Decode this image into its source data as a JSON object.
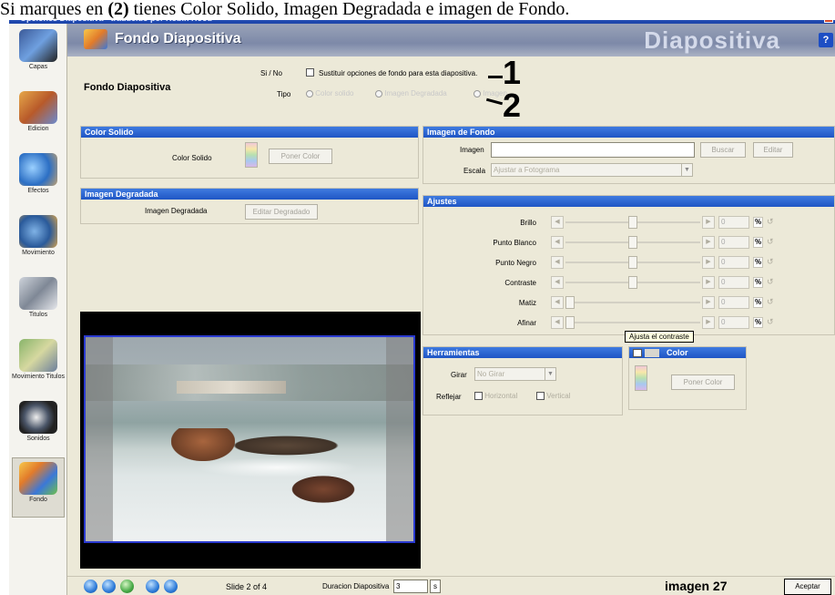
{
  "caption": "Si marques en (2) tienes Color Solido, Imagen Degradada e imagen de Fondo.",
  "caption_bold": "(2)",
  "window_title": "Opciones Diapositiva - traducido por Robin Hood",
  "sidebar": {
    "items": [
      {
        "label": "Capas",
        "icon": "layers-icon"
      },
      {
        "label": "Edicion",
        "icon": "edit-icon"
      },
      {
        "label": "Efectos",
        "icon": "effects-icon"
      },
      {
        "label": "Movimiento",
        "icon": "motion-icon"
      },
      {
        "label": "Titulos",
        "icon": "titles-icon"
      },
      {
        "label": "Movimiento Titulos",
        "icon": "title-motion-icon"
      },
      {
        "label": "Sonidos",
        "icon": "sounds-icon"
      },
      {
        "label": "Fondo",
        "icon": "background-icon"
      }
    ]
  },
  "header": {
    "title": "Fondo Diapositiva",
    "big_title": "Diapositiva",
    "help": "?"
  },
  "top": {
    "section_label": "Fondo Diapositiva",
    "sino_label": "Si / No",
    "sino_text": "Sustituir opciones de fondo para esta diapositiva.",
    "tipo_label": "Tipo",
    "tipo_options": [
      "Color solido",
      "Imagen Degradada",
      "Imagen"
    ],
    "annotation_1": "1",
    "annotation_2": "2"
  },
  "color_solido": {
    "header": "Color Solido",
    "label": "Color Solido",
    "button": "Poner Color"
  },
  "imagen_degradada": {
    "header": "Imagen Degradada",
    "label": "Imagen Degradada",
    "button": "Editar Degradado"
  },
  "imagen_fondo": {
    "header": "Imagen de Fondo",
    "imagen_label": "Imagen",
    "imagen_value": "",
    "buscar": "Buscar",
    "editar": "Editar",
    "escala_label": "Escala",
    "escala_value": "Ajustar a Fotograma"
  },
  "ajustes": {
    "header": "Ajustes",
    "rows": [
      {
        "label": "Brillo",
        "value": "0",
        "pct": "%",
        "pos": 0.5
      },
      {
        "label": "Punto Blanco",
        "value": "0",
        "pct": "%",
        "pos": 0.5
      },
      {
        "label": "Punto Negro",
        "value": "0",
        "pct": "%",
        "pos": 0.5
      },
      {
        "label": "Contraste",
        "value": "0",
        "pct": "%",
        "pos": 0.5
      },
      {
        "label": "Matiz",
        "value": "0",
        "pct": "%",
        "pos": 0.0
      },
      {
        "label": "Afinar",
        "value": "0",
        "pct": "%",
        "pos": 0.0
      }
    ],
    "tooltip": "Ajusta el contraste"
  },
  "herramientas": {
    "header": "Herramientas",
    "girar_label": "Girar",
    "girar_value": "No Girar",
    "reflejar_label": "Reflejar",
    "horizontal": "Horizontal",
    "vertical": "Vertical"
  },
  "color_box": {
    "header": "Color",
    "button": "Poner Color"
  },
  "footer": {
    "slide": "Slide 2 of 4",
    "duracion_label": "Duracion Diapositiva",
    "duracion_value": "3",
    "duracion_unit": "s",
    "image_caption": "imagen 27",
    "accept": "Aceptar"
  }
}
